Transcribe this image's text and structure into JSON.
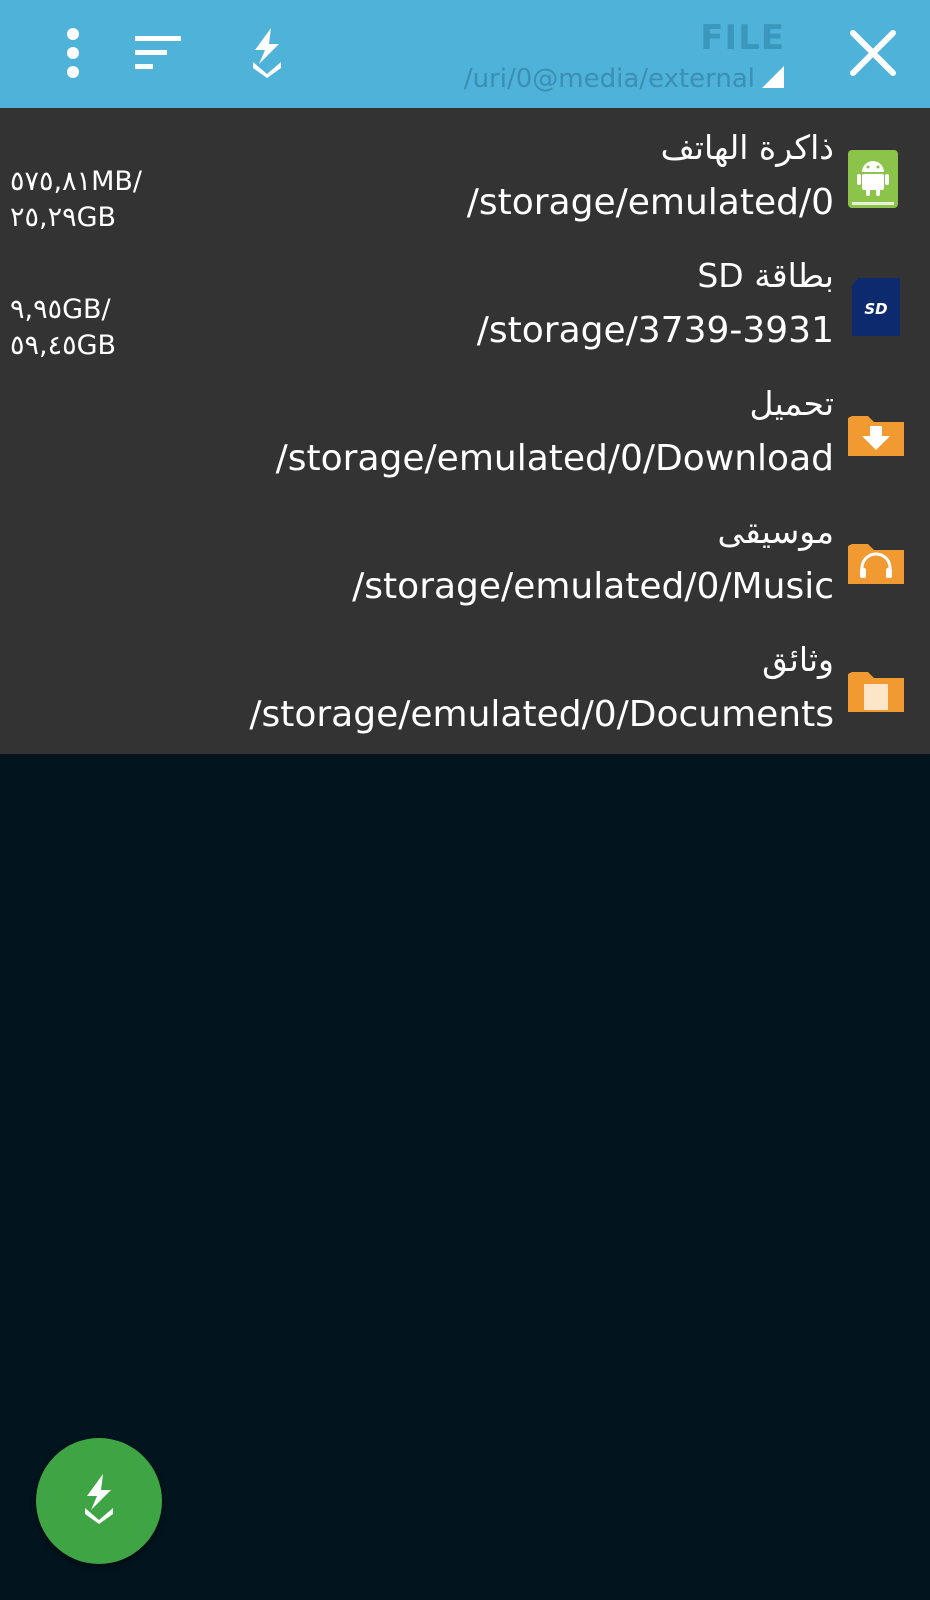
{
  "toolbar": {
    "title": "FILE",
    "path": "/uri/0@media/external",
    "icons": [
      "more-vert-icon",
      "sort-icon",
      "download-app-icon",
      "close-icon"
    ]
  },
  "storage": [
    {
      "label": "ذاكرة الهاتف",
      "path": "/storage/emulated/0",
      "size_line1": "٥٧٥,٨١MB/",
      "size_line2": "٢٥,٢٩GB",
      "icon": "android-storage-icon"
    },
    {
      "label": "بطاقة SD",
      "path": "/storage/3739-3931",
      "size_line1": "٩,٩٥GB/",
      "size_line2": "٥٩,٤٥GB",
      "icon": "sd-card-icon"
    },
    {
      "label": "تحميل",
      "path": "/storage/emulated/0/Download",
      "icon": "download-folder-icon"
    },
    {
      "label": "موسيقى",
      "path": "/storage/emulated/0/Music",
      "icon": "music-folder-icon"
    },
    {
      "label": "وثائق",
      "path": "/storage/emulated/0/Documents",
      "icon": "documents-folder-icon"
    }
  ],
  "fab": {
    "icon": "download-icon"
  },
  "colors": {
    "toolbar": "#4fb2d9",
    "panel": "#333333",
    "background": "#02141d",
    "fab": "#3ea444",
    "folder": "#f29a32",
    "android": "#8cc34a",
    "sd": "#0d2a6e"
  }
}
